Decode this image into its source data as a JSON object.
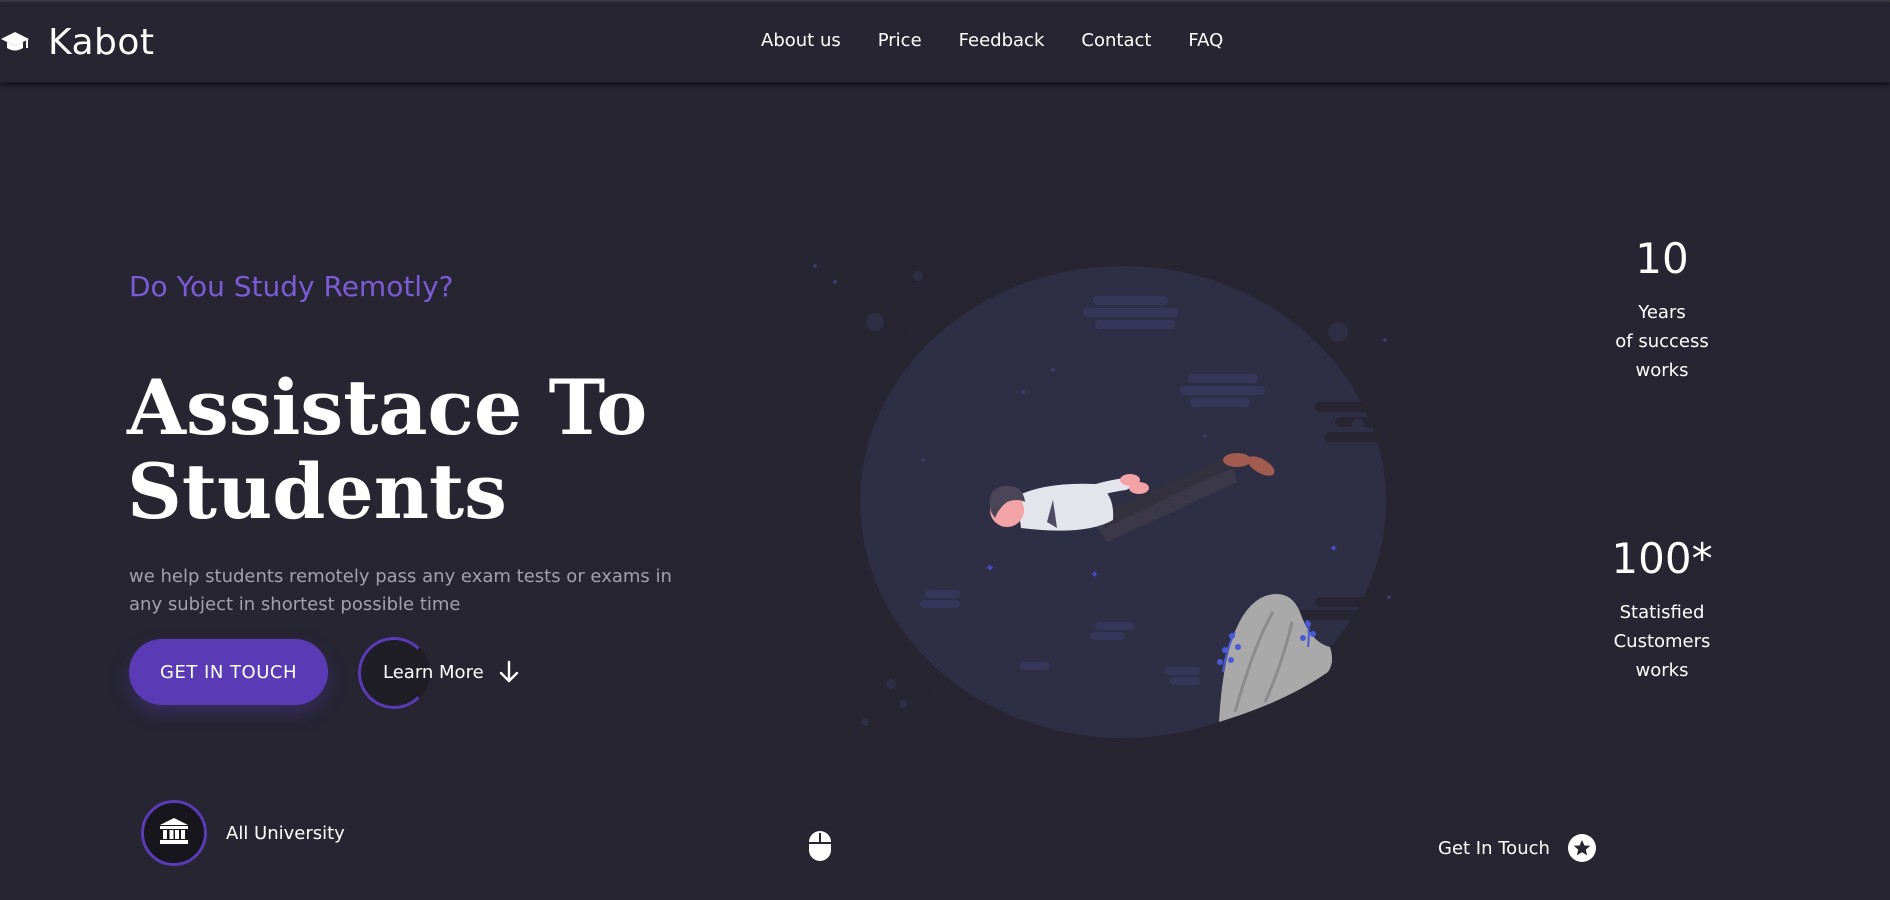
{
  "brand": {
    "name": "Kabot",
    "icon": "graduation-cap-icon"
  },
  "nav": {
    "items": [
      {
        "label": "About us"
      },
      {
        "label": "Price"
      },
      {
        "label": "Feedback"
      },
      {
        "label": "Contact"
      },
      {
        "label": "FAQ"
      }
    ]
  },
  "hero": {
    "subtitle": "Do You Study Remotly?",
    "title_line1": "Assistace To",
    "title_line2": "Students",
    "description": "we help students remotely pass any exam tests or exams in any subject in shortest possible time",
    "primary_button": "GET IN TOUCH",
    "secondary_button": "Learn More",
    "secondary_icon": "arrow-down-icon"
  },
  "illustration": {
    "icon": "person-flying-illustration"
  },
  "stats": [
    {
      "value": "10",
      "label_line1": "Years",
      "label_line2": "of success",
      "label_line3": "works"
    },
    {
      "value": "100*",
      "label_line1": "Statisfied",
      "label_line2": "Customers",
      "label_line3": "works"
    }
  ],
  "footer": {
    "university_label": "All University",
    "university_icon": "university-icon",
    "scroll_icon": "mouse-icon",
    "contact_label": "Get In Touch",
    "contact_icon": "star-icon"
  },
  "colors": {
    "background": "#262531",
    "accent": "#5a3bb5",
    "subtitle": "#7b5bd6",
    "muted_text": "#a3a2ab"
  }
}
